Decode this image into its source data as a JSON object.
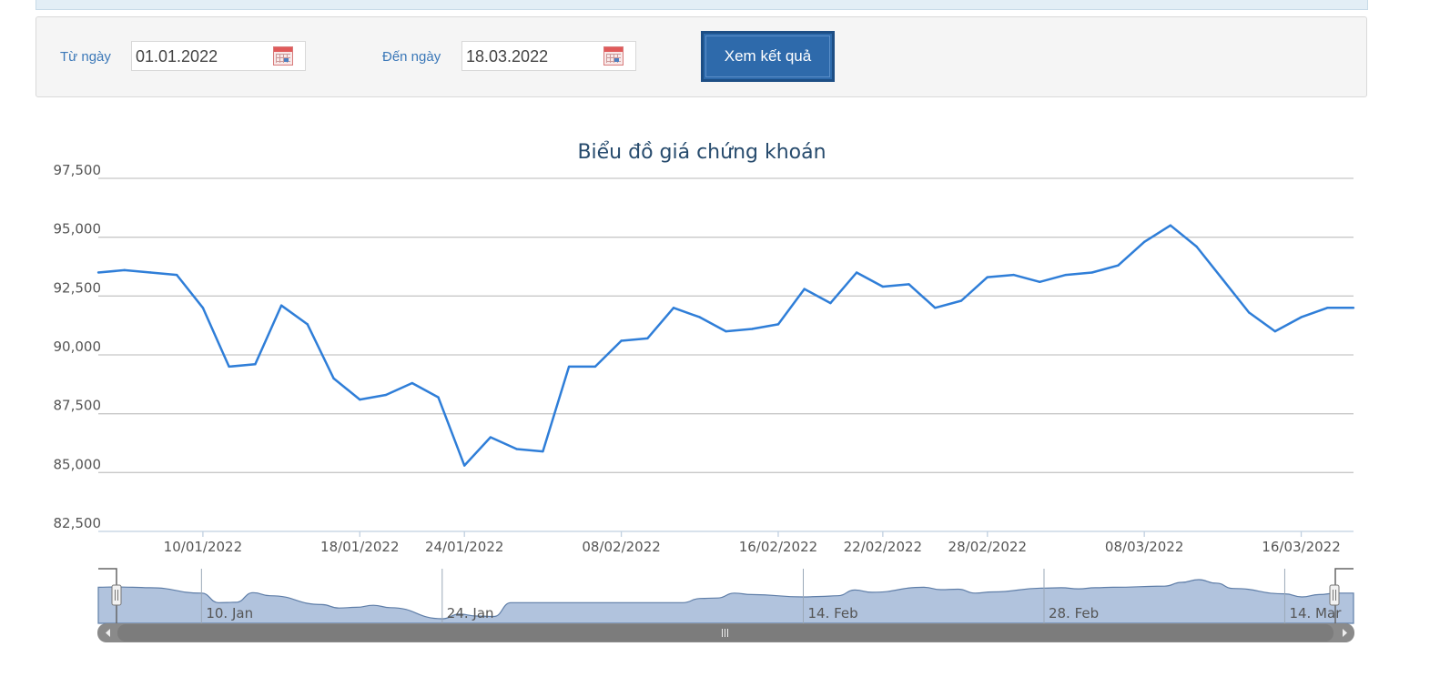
{
  "filter": {
    "from_label": "Từ ngày",
    "from_value": "01.01.2022",
    "to_label": "Đến ngày",
    "to_value": "18.03.2022",
    "submit_label": "Xem kết quả"
  },
  "colors": {
    "line": "#2f7ed8",
    "navigator_fill": "#b1c3dd",
    "navigator_line": "#5f7ea8",
    "accent": "#2e6aab"
  },
  "chart_data": {
    "type": "line",
    "title": "Biểu đồ giá chứng khoán",
    "ylim": [
      82500,
      97500
    ],
    "y_ticks": [
      "82,500",
      "85,000",
      "87,500",
      "90,000",
      "92,500",
      "95,000",
      "97,500"
    ],
    "x_tick_labels": [
      "10/01/2022",
      "18/01/2022",
      "24/01/2022",
      "08/02/2022",
      "16/02/2022",
      "22/02/2022",
      "28/02/2022",
      "08/03/2022",
      "16/03/2022"
    ],
    "grid": true,
    "series": [
      {
        "x": [
          "04/01/2022",
          "05/01/2022",
          "06/01/2022",
          "07/01/2022",
          "10/01/2022",
          "11/01/2022",
          "12/01/2022",
          "13/01/2022",
          "14/01/2022",
          "17/01/2022",
          "18/01/2022",
          "19/01/2022",
          "20/01/2022",
          "21/01/2022",
          "24/01/2022",
          "25/01/2022",
          "26/01/2022",
          "27/01/2022",
          "28/01/2022",
          "07/02/2022",
          "08/02/2022",
          "09/02/2022",
          "10/02/2022",
          "11/02/2022",
          "14/02/2022",
          "15/02/2022",
          "16/02/2022",
          "17/02/2022",
          "18/02/2022",
          "21/02/2022",
          "22/02/2022",
          "23/02/2022",
          "24/02/2022",
          "25/02/2022",
          "28/02/2022",
          "01/03/2022",
          "02/03/2022",
          "03/03/2022",
          "04/03/2022",
          "07/03/2022",
          "08/03/2022",
          "09/03/2022",
          "10/03/2022",
          "11/03/2022",
          "14/03/2022",
          "15/03/2022",
          "16/03/2022",
          "17/03/2022",
          "18/03/2022"
        ],
        "values": [
          93500,
          93600,
          93500,
          93400,
          92000,
          89500,
          89600,
          92100,
          91300,
          89000,
          88100,
          88300,
          88800,
          88200,
          85300,
          86500,
          86000,
          85900,
          89500,
          89500,
          90600,
          90700,
          92000,
          91600,
          91000,
          91100,
          91300,
          92800,
          92200,
          93500,
          92900,
          93000,
          92000,
          92300,
          93300,
          93400,
          93100,
          93400,
          93500,
          93800,
          94800,
          95500,
          94600,
          93200,
          91800,
          91000,
          91600,
          92000,
          92000
        ]
      }
    ],
    "navigator": {
      "labels": [
        "10. Jan",
        "24. Jan",
        "14. Feb",
        "28. Feb",
        "14. Mar"
      ]
    }
  }
}
